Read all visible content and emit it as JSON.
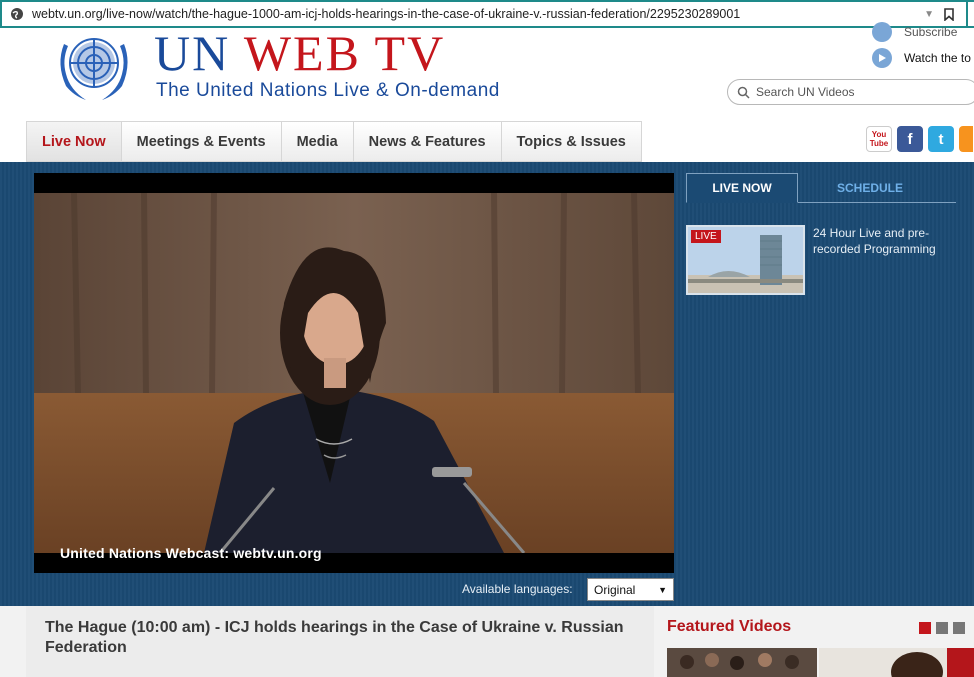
{
  "browser": {
    "url": "webtv.un.org/live-now/watch/the-hague-1000-am-icj-holds-hearings-in-the-case-of-ukraine-v.-russian-federation/2295230289001"
  },
  "header": {
    "title_un": "UN",
    "title_web": "WEB",
    "title_tv": "TV",
    "tagline": "The United Nations Live & On-demand",
    "subscribe_label": "Subscribe",
    "watch_label": "Watch the to",
    "search_placeholder": "Search UN Videos"
  },
  "nav": {
    "tabs": [
      {
        "label": "Live Now",
        "active": true
      },
      {
        "label": "Meetings & Events"
      },
      {
        "label": "Media"
      },
      {
        "label": "News & Features"
      },
      {
        "label": "Topics & Issues"
      }
    ]
  },
  "social": {
    "youtube": "You Tube",
    "facebook": "f",
    "twitter": "t"
  },
  "player": {
    "overlay_text": "United Nations Webcast: webtv.un.org",
    "languages_label": "Available languages:",
    "language_selected": "Original"
  },
  "sidebar": {
    "tab_live": "LIVE NOW",
    "tab_schedule": "SCHEDULE",
    "live_badge": "LIVE",
    "live_description": "24 Hour Live and pre-recorded Programming"
  },
  "content": {
    "video_title": "The Hague (10:00 am) - ICJ holds hearings in the Case of Ukraine v. Russian Federation",
    "featured_heading": "Featured Videos"
  },
  "colors": {
    "brand_blue": "#1a4a9a",
    "brand_red": "#c4161c",
    "panel_blue": "#1b4a73"
  }
}
